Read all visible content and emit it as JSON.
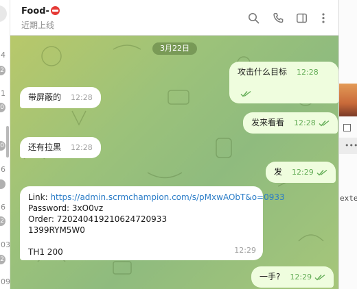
{
  "sidebar_fragment": {
    "numbers": [
      "4",
      "1",
      "6",
      "6",
      "03",
      "03",
      "09"
    ],
    "badges": [
      "2",
      "0",
      "0",
      "",
      "2",
      "2",
      "0"
    ]
  },
  "header": {
    "title": "Food-",
    "status": "近期上线",
    "icons": [
      "search-icon",
      "phone-icon",
      "sidebar-toggle-icon",
      "more-vertical-icon"
    ]
  },
  "date_chip": "3月22日",
  "messages": [
    {
      "dir": "out",
      "text": "攻击什么目标",
      "time": "12:28"
    },
    {
      "dir": "in",
      "text": "带屏蔽的",
      "time": "12:28"
    },
    {
      "dir": "out",
      "text": "发来看看",
      "time": "12:28"
    },
    {
      "dir": "in",
      "text": "还有拉黑",
      "time": "12:28"
    },
    {
      "dir": "out",
      "text": "发",
      "time": "12:29"
    },
    {
      "dir": "in",
      "time": "12:29",
      "lines": {
        "link_prefix": "Link: ",
        "link_url": "https://admin.scrmchampion.com/s/pMxwAObT&o=0933",
        "password": "Password: 3xO0vz",
        "order": "Order: 7202404192106247209​33",
        "code": "1399RYM5W0",
        "blank": "",
        "amount": "TH1  200"
      }
    },
    {
      "dir": "out",
      "text": "一手?",
      "time": "12:29"
    }
  ],
  "right_fragment": {
    "text": "exten"
  },
  "colors": {
    "out_bubble": "#effdde",
    "in_bubble": "#ffffff",
    "link": "#2a7cc7",
    "tick": "#62ac55"
  }
}
